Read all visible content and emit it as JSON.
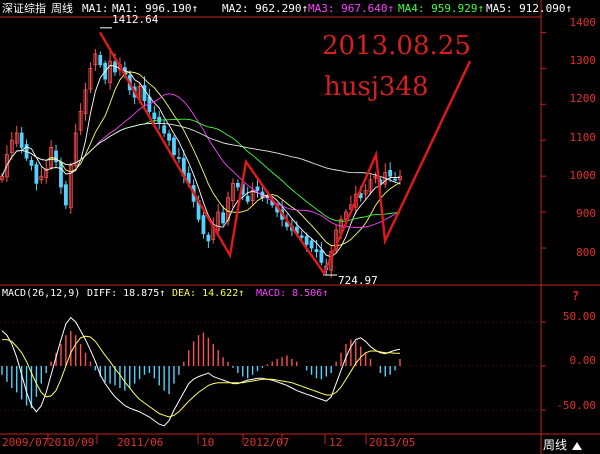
{
  "header": {
    "index_name": "深证综指",
    "period": "周线",
    "ma": [
      {
        "label": "MA1:",
        "value": "",
        "color": "#ffffff"
      },
      {
        "label": "MA1:",
        "value": "996.190↑",
        "color": "#ffffff"
      },
      {
        "label": "MA2:",
        "value": "962.290↑",
        "color": "#ffffff"
      },
      {
        "label": "MA3:",
        "value": "967.640↑",
        "color": "#ff40ff"
      },
      {
        "label": "MA4:",
        "value": "959.929↑",
        "color": "#40ff40"
      },
      {
        "label": "MA5:",
        "value": "912.090↑",
        "color": "#ffffff"
      }
    ],
    "arrow_glyph": "↑"
  },
  "price_axis": {
    "ticks": [
      "1400",
      "1300",
      "1200",
      "1100",
      "1000",
      "900",
      "800"
    ]
  },
  "macd_header": {
    "name": "MACD(26,12,9)",
    "diff_label": "DIFF: 18.875↑",
    "dea_label": "DEA: 14.622↑",
    "macd_label": "MACD: 8.506↑"
  },
  "macd_axis": {
    "ticks": [
      "50.00",
      "0.00",
      "-50.00"
    ]
  },
  "annotations": {
    "high_label": "1412.64",
    "low_label": "724.97",
    "date_text": "2013.08.25",
    "user_text": "husj348"
  },
  "time_axis": {
    "labels": [
      "2009/07",
      "2010/09",
      "2011/06",
      "10",
      "2012/07",
      "12",
      "2013/05"
    ]
  },
  "period_button": {
    "label": "周线",
    "icon": "triangle-up-icon"
  },
  "help_icon": {
    "glyph": "?"
  },
  "colors": {
    "background": "#000000",
    "axis_red": "#c8201e",
    "up_candle": "#ff5050",
    "down_candle": "#54d2ff",
    "trend_line": "#e01a1a"
  },
  "chart_data": [
    {
      "type": "candlestick",
      "title": "深证综指 周线",
      "ylim": [
        700,
        1440
      ],
      "series": [
        {
          "name": "MA1",
          "last": 996.19
        },
        {
          "name": "MA2",
          "last": 962.29
        },
        {
          "name": "MA3",
          "last": 967.64
        },
        {
          "name": "MA4",
          "last": 959.929
        },
        {
          "name": "MA5",
          "last": 912.09
        }
      ],
      "annotations": [
        {
          "label": "1412.64",
          "y": 1412.64,
          "kind": "high"
        },
        {
          "label": "724.97",
          "y": 724.97,
          "kind": "low"
        }
      ],
      "trend_line_y": [
        1400,
        780,
        1040,
        730,
        1060,
        820,
        1320
      ],
      "close": [
        1000,
        1060,
        1100,
        1120,
        1080,
        1050,
        1030,
        980,
        1000,
        1020,
        1080,
        1040,
        970,
        920,
        1030,
        1120,
        1180,
        1240,
        1300,
        1340,
        1310,
        1270,
        1320,
        1290,
        1310,
        1280,
        1240,
        1220,
        1250,
        1210,
        1180,
        1160,
        1150,
        1120,
        1100,
        1060,
        1050,
        1000,
        980,
        930,
        880,
        840,
        820,
        860,
        900,
        870,
        940,
        980,
        970,
        950,
        930,
        960,
        960,
        940,
        940,
        920,
        900,
        880,
        860,
        850,
        840,
        830,
        810,
        800,
        790,
        760,
        740,
        790,
        850,
        880,
        900,
        920,
        950,
        940,
        960,
        990,
        1000,
        980,
        1010,
        1000,
        990,
        1000
      ]
    },
    {
      "type": "bar",
      "title": "MACD(26,12,9)",
      "ylim": [
        -75,
        75
      ],
      "series": [
        {
          "name": "DIFF",
          "last": 18.875
        },
        {
          "name": "DEA",
          "last": 14.622
        },
        {
          "name": "MACD",
          "last": 8.506
        }
      ],
      "macd": [
        -10,
        -18,
        -25,
        -30,
        -38,
        -45,
        -48,
        -35,
        -20,
        -8,
        5,
        15,
        25,
        35,
        40,
        35,
        25,
        15,
        5,
        -5,
        -12,
        -18,
        -20,
        -22,
        -25,
        -28,
        -25,
        -20,
        -15,
        -10,
        -8,
        -14,
        -22,
        -28,
        -32,
        -20,
        -10,
        5,
        18,
        28,
        35,
        38,
        32,
        25,
        18,
        10,
        5,
        -2,
        -8,
        -12,
        -14,
        -10,
        -6,
        -2,
        2,
        5,
        8,
        10,
        12,
        8,
        5,
        0,
        -5,
        -10,
        -14,
        -15,
        -12,
        -8,
        5,
        15,
        25,
        30,
        28,
        22,
        15,
        8,
        0,
        -8,
        -12,
        -10,
        -5,
        8
      ],
      "diff": [
        40,
        35,
        25,
        10,
        -10,
        -30,
        -45,
        -52,
        -45,
        -30,
        -10,
        10,
        30,
        48,
        55,
        50,
        40,
        30,
        18,
        5,
        -10,
        -20,
        -28,
        -35,
        -40,
        -45,
        -48,
        -50,
        -52,
        -55,
        -58,
        -62,
        -66,
        -68,
        -62,
        -50,
        -40,
        -30,
        -20,
        -15,
        -12,
        -10,
        -8,
        -12,
        -14,
        -16,
        -18,
        -20,
        -20,
        -18,
        -16,
        -15,
        -14,
        -14,
        -15,
        -16,
        -18,
        -20,
        -22,
        -25,
        -28,
        -30,
        -32,
        -34,
        -36,
        -38,
        -40,
        -35,
        -20,
        -5,
        10,
        22,
        30,
        32,
        28,
        22,
        18,
        15,
        14,
        16,
        18,
        19
      ],
      "dea": [
        30,
        30,
        28,
        22,
        15,
        5,
        -8,
        -20,
        -30,
        -35,
        -34,
        -28,
        -15,
        0,
        15,
        25,
        32,
        34,
        33,
        28,
        20,
        12,
        5,
        -3,
        -10,
        -18,
        -25,
        -32,
        -38,
        -42,
        -46,
        -50,
        -54,
        -56,
        -58,
        -56,
        -52,
        -46,
        -40,
        -35,
        -30,
        -26,
        -22,
        -20,
        -19,
        -19,
        -19,
        -19,
        -19,
        -19,
        -18,
        -17,
        -16,
        -15,
        -15,
        -15,
        -16,
        -17,
        -18,
        -19,
        -21,
        -23,
        -25,
        -27,
        -29,
        -31,
        -33,
        -33,
        -30,
        -24,
        -15,
        -6,
        3,
        10,
        15,
        17,
        17,
        16,
        15,
        15,
        14.6,
        14.6
      ]
    }
  ]
}
